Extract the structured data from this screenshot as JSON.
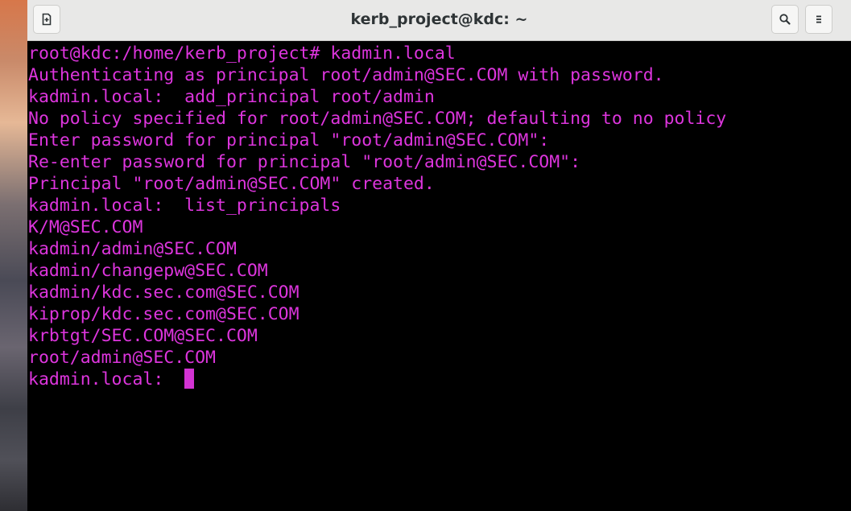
{
  "window": {
    "title": "kerb_project@kdc: ~",
    "buttons": {
      "new_tab_icon": "new-tab-icon",
      "search_icon": "search-icon",
      "menu_icon": "hamburger-menu-icon"
    }
  },
  "terminal": {
    "text_color": "#dd35dd",
    "background": "#000000",
    "lines": [
      "root@kdc:/home/kerb_project# kadmin.local",
      "Authenticating as principal root/admin@SEC.COM with password.",
      "kadmin.local:  add_principal root/admin",
      "No policy specified for root/admin@SEC.COM; defaulting to no policy",
      "Enter password for principal \"root/admin@SEC.COM\":",
      "Re-enter password for principal \"root/admin@SEC.COM\":",
      "Principal \"root/admin@SEC.COM\" created.",
      "kadmin.local:  list_principals",
      "K/M@SEC.COM",
      "kadmin/admin@SEC.COM",
      "kadmin/changepw@SEC.COM",
      "kadmin/kdc.sec.com@SEC.COM",
      "kiprop/kdc.sec.com@SEC.COM",
      "krbtgt/SEC.COM@SEC.COM",
      "root/admin@SEC.COM"
    ],
    "prompt": "kadmin.local:  "
  }
}
